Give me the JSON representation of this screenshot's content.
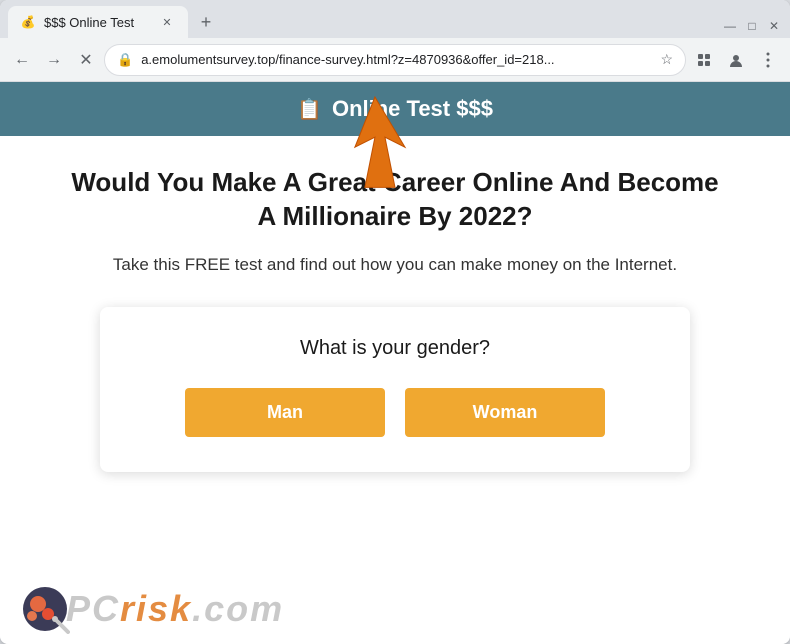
{
  "browser": {
    "tab_title": "$$$ Online Test",
    "tab_favicon": "💰",
    "new_tab_label": "+",
    "minimize_label": "—",
    "maximize_label": "□",
    "close_label": "✕"
  },
  "navbar": {
    "back_label": "←",
    "forward_label": "→",
    "close_label": "✕",
    "lock_icon": "🔒",
    "address": "a.emolumentsurvey.top/finance-survey.html?z=4870936&offer_id=218...",
    "star_icon": "☆",
    "extensions_icon": "🧩",
    "profile_icon": "👤",
    "menu_icon": "⋮"
  },
  "site": {
    "header_icon": "📋",
    "header_title": "Online Test $$$",
    "main_heading": "Would You Make A Great Career Online And Become A Millionaire By 2022?",
    "sub_heading": "Take this FREE test and find out how you can make money on the Internet.",
    "gender_question": "What is your gender?",
    "man_button": "Man",
    "woman_button": "Woman"
  },
  "watermark": {
    "text_pc": "PC",
    "text_risk": "risk",
    "text_com": ".com"
  }
}
